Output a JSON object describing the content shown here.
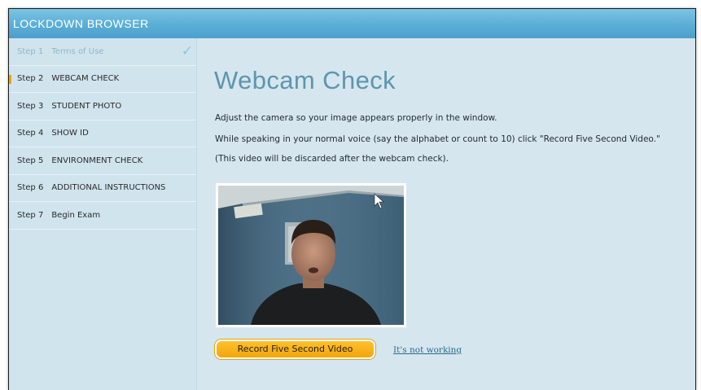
{
  "app": {
    "title": "LOCKDOWN BROWSER"
  },
  "steps": [
    {
      "num": "Step 1",
      "label": "Terms of Use",
      "state": "done"
    },
    {
      "num": "Step 2",
      "label": "WEBCAM CHECK",
      "state": "active"
    },
    {
      "num": "Step 3",
      "label": "STUDENT PHOTO",
      "state": "pending"
    },
    {
      "num": "Step 4",
      "label": "SHOW ID",
      "state": "pending"
    },
    {
      "num": "Step 5",
      "label": "ENVIRONMENT CHECK",
      "state": "pending"
    },
    {
      "num": "Step 6",
      "label": "ADDITIONAL INSTRUCTIONS",
      "state": "pending"
    },
    {
      "num": "Step 7",
      "label": "Begin Exam",
      "state": "pending"
    }
  ],
  "main": {
    "title": "Webcam Check",
    "instructions": [
      "Adjust the camera so your image appears properly in the window.",
      "While speaking in your normal voice (say the alphabet or count to 10) click \"Record Five Second Video.\"",
      "(This video will be discarded after the webcam check)."
    ],
    "record_button": "Record Five Second Video",
    "help_link": "It's not working"
  },
  "colors": {
    "accent": "#f2a50a",
    "titlebar": "#5aaed6",
    "background": "#d6e6ef",
    "title_text": "#5d96ad"
  },
  "icons": {
    "step_complete": "check-icon",
    "cursor": "mouse-pointer-icon"
  }
}
